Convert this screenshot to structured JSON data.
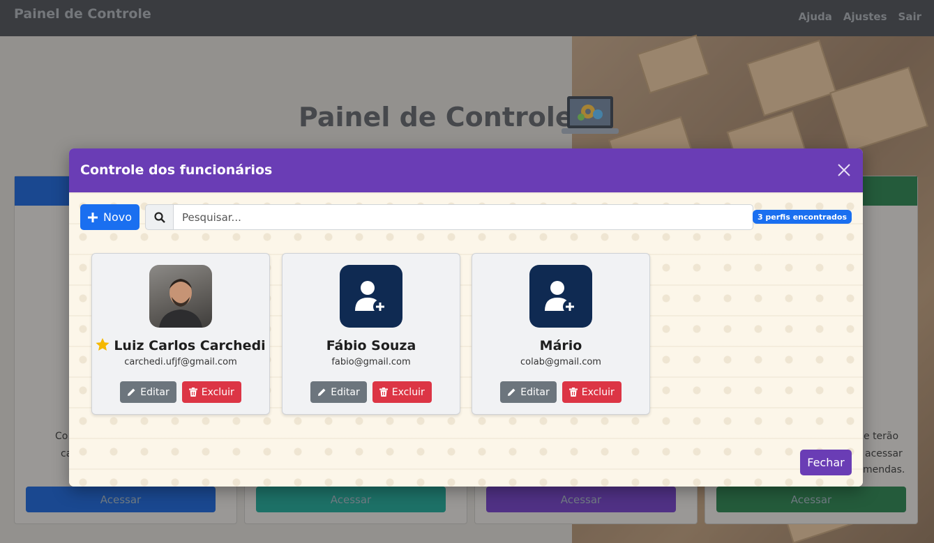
{
  "navbar": {
    "brand": "Painel de Controle",
    "links": [
      "Ajuda",
      "Ajustes",
      "Sair"
    ]
  },
  "page": {
    "title": "Painel de Controle",
    "cards": [
      {
        "accent": "#0b4fb8",
        "button": "Acessar"
      },
      {
        "accent": "#0f8b7d",
        "button": "Acessar"
      },
      {
        "accent": "#5b2da8",
        "button": "Acessar"
      },
      {
        "accent": "#1a6b3c",
        "button": "Acessar"
      }
    ],
    "partial_text": {
      "left_1": "Co",
      "left_2": "ca",
      "right_1": "e terão",
      "right_2": "acessar",
      "right_3": "mendas."
    }
  },
  "modal": {
    "title": "Controle dos funcionários",
    "new_button": "Novo",
    "search_placeholder": "Pesquisar...",
    "count_badge": "3 perfis encontrados",
    "close_button": "Fechar",
    "employees": [
      {
        "name": "Luiz Carlos Carchedi",
        "email": "carchedi.ufjf@gmail.com",
        "avatar": "photo",
        "favorite": true,
        "edit": "Editar",
        "delete": "Excluir"
      },
      {
        "name": "Fábio Souza",
        "email": "fabio@gmail.com",
        "avatar": "user-plus-icon",
        "favorite": false,
        "edit": "Editar",
        "delete": "Excluir"
      },
      {
        "name": "Mário",
        "email": "colab@gmail.com",
        "avatar": "user-plus-icon",
        "favorite": false,
        "edit": "Editar",
        "delete": "Excluir"
      }
    ]
  },
  "colors": {
    "modal_header": "#6a3db5",
    "primary": "#1a6ff0",
    "danger": "#dc3545",
    "secondary": "#6c757d",
    "avatar_bg": "#0f2a52"
  }
}
